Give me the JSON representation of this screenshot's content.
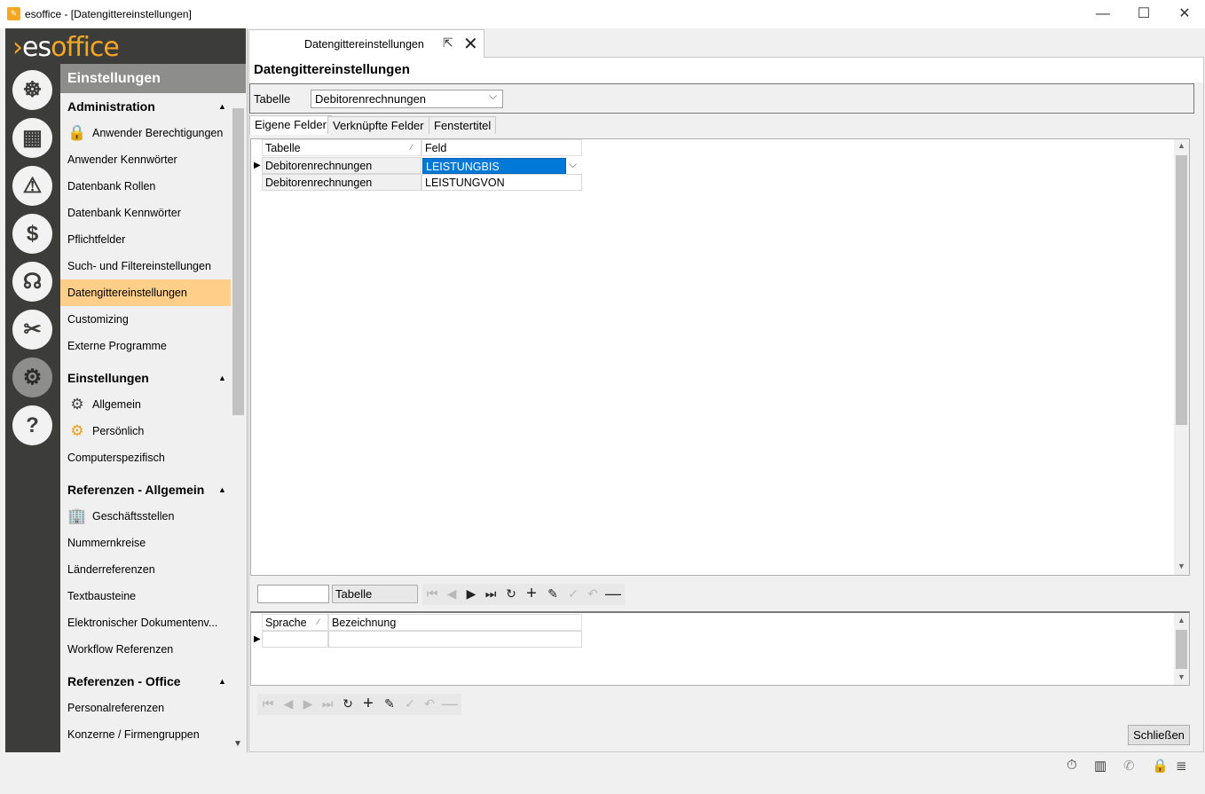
{
  "window": {
    "title": "esoffice - [Datengittereinstellungen]",
    "controls": {
      "minimize": "—",
      "maximize": "☐",
      "close": "✕"
    }
  },
  "logo": {
    "part1": "es",
    "part2": "office"
  },
  "rail": {
    "items": [
      {
        "icon": "helm-icon",
        "glyph": "☸"
      },
      {
        "icon": "calendar-icon",
        "glyph": "▦"
      },
      {
        "icon": "alarm-icon",
        "glyph": "⚠"
      },
      {
        "icon": "money-icon",
        "glyph": "$"
      },
      {
        "icon": "headset-icon",
        "glyph": "☊"
      },
      {
        "icon": "tools-icon",
        "glyph": "✂"
      },
      {
        "icon": "settings-gears-icon",
        "glyph": "⚙"
      },
      {
        "icon": "help-icon",
        "glyph": "?"
      }
    ]
  },
  "sidebar": {
    "header": "Einstellungen",
    "sections": [
      {
        "title": "Administration",
        "items": [
          {
            "label": "Anwender Berechtigungen",
            "icon": "user-lock-icon",
            "glyph": "🔒"
          },
          {
            "label": "Anwender Kennwörter"
          },
          {
            "label": "Datenbank Rollen"
          },
          {
            "label": "Datenbank Kennwörter"
          },
          {
            "label": "Pflichtfelder"
          },
          {
            "label": "Such- und Filtereinstellungen"
          },
          {
            "label": "Datengittereinstellungen",
            "active": true
          },
          {
            "label": "Customizing"
          },
          {
            "label": "Externe Programme"
          }
        ]
      },
      {
        "title": "Einstellungen",
        "items": [
          {
            "label": "Allgemein",
            "icon": "gears-icon",
            "glyph": "⚙"
          },
          {
            "label": "Persönlich",
            "icon": "user-gears-icon",
            "glyph": "⚙"
          },
          {
            "label": "Computerspezifisch"
          }
        ]
      },
      {
        "title": "Referenzen - Allgemein",
        "items": [
          {
            "label": "Geschäftsstellen",
            "icon": "building-icon",
            "glyph": "🏢"
          },
          {
            "label": "Nummernkreise"
          },
          {
            "label": "Länderreferenzen"
          },
          {
            "label": "Textbausteine"
          },
          {
            "label": "Elektronischer Dokumentenv..."
          },
          {
            "label": "Workflow Referenzen"
          }
        ]
      },
      {
        "title": "Referenzen - Office",
        "items": [
          {
            "label": "Personalreferenzen"
          },
          {
            "label": "Konzerne / Firmengruppen"
          }
        ]
      }
    ]
  },
  "tab": {
    "label": "Datengittereinstellungen"
  },
  "page": {
    "title": "Datengittereinstellungen",
    "table_label": "Tabelle",
    "table_value": "Debitorenrechnungen",
    "subtabs": [
      "Eigene Felder",
      "Verknüpfte Felder",
      "Fenstertitel"
    ]
  },
  "grid1": {
    "columns": [
      "Tabelle",
      "Feld"
    ],
    "rows": [
      [
        "Debitorenrechnungen",
        "LEISTUNGBIS"
      ],
      [
        "Debitorenrechnungen",
        "LEISTUNGVON"
      ]
    ]
  },
  "navigator1": {
    "label": "Tabelle"
  },
  "grid2": {
    "columns": [
      "Sprache",
      "Bezeichnung"
    ]
  },
  "footer": {
    "close_label": "Schließen"
  }
}
